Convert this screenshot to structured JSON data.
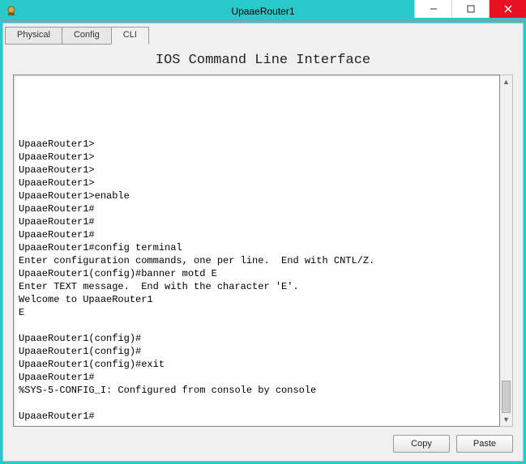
{
  "window": {
    "title": "UpaaeRouter1"
  },
  "tabs": {
    "physical": "Physical",
    "config": "Config",
    "cli": "CLI"
  },
  "heading": "IOS Command Line Interface",
  "terminal_output": "UpaaeRouter1>\nUpaaeRouter1>\nUpaaeRouter1>\nUpaaeRouter1>\nUpaaeRouter1>enable\nUpaaeRouter1#\nUpaaeRouter1#\nUpaaeRouter1#\nUpaaeRouter1#config terminal\nEnter configuration commands, one per line.  End with CNTL/Z.\nUpaaeRouter1(config)#banner motd E\nEnter TEXT message.  End with the character 'E'.\nWelcome to UpaaeRouter1\nE\n\nUpaaeRouter1(config)#\nUpaaeRouter1(config)#\nUpaaeRouter1(config)#exit\nUpaaeRouter1#\n%SYS-5-CONFIG_I: Configured from console by console\n\nUpaaeRouter1#",
  "buttons": {
    "copy": "Copy",
    "paste": "Paste"
  }
}
